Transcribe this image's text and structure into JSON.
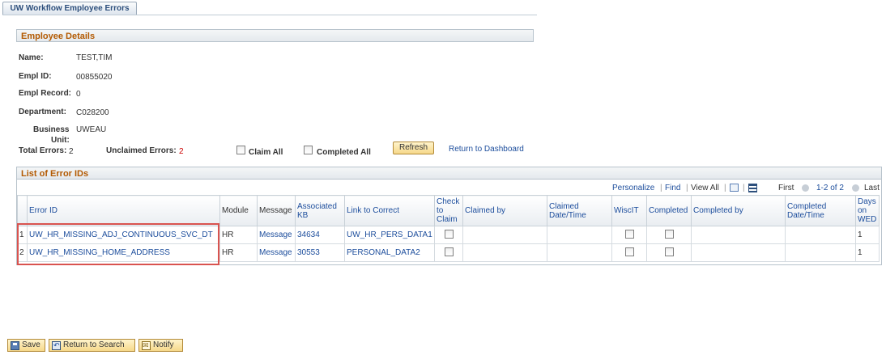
{
  "tab": {
    "label": "UW Workflow Employee Errors"
  },
  "employee_details": {
    "header": "Employee Details",
    "name_label": "Name:",
    "name_value": "TEST,TIM",
    "emplid_label": "Empl ID:",
    "emplid_value": "00855020",
    "empl_record_label": "Empl Record:",
    "empl_record_value": "0",
    "department_label": "Department:",
    "department_value": "C028200",
    "business_unit_label_1": "Business",
    "business_unit_label_2": "Unit:",
    "business_unit_value": "UWEAU",
    "total_errors_label": "Total Errors:",
    "total_errors_value": "2",
    "unclaimed_errors_label": "Unclaimed Errors:",
    "unclaimed_errors_value": "2",
    "claim_all_label": "Claim All",
    "completed_all_label": "Completed All",
    "refresh_label": "Refresh",
    "return_dashboard_label": "Return to Dashboard"
  },
  "error_list": {
    "header": "List of Error IDs",
    "nav": {
      "personalize": "Personalize",
      "find": "Find",
      "view_all": "View All",
      "first": "First",
      "range": "1-2 of 2",
      "last": "Last"
    },
    "columns": {
      "error_id": "Error ID",
      "module": "Module",
      "message": "Message",
      "associated_kb_1": "Associated",
      "associated_kb_2": "KB",
      "link_to_correct": "Link to Correct",
      "check_to_claim_1": "Check",
      "check_to_claim_2": "to",
      "check_to_claim_3": "Claim",
      "claimed_by": "Claimed by",
      "claimed_datetime_1": "Claimed",
      "claimed_datetime_2": "Date/Time",
      "wiscit": "WiscIT",
      "completed": "Completed",
      "completed_by": "Completed by",
      "completed_datetime_1": "Completed",
      "completed_datetime_2": "Date/Time",
      "days_on_wed_1": "Days",
      "days_on_wed_2": "on",
      "days_on_wed_3": "WED"
    },
    "rows": [
      {
        "num": "1",
        "error_id": "UW_HR_MISSING_ADJ_CONTINUOUS_SVC_DT",
        "module": "HR",
        "message": "Message",
        "kb": "34634",
        "link": "UW_HR_PERS_DATA1",
        "days": "1"
      },
      {
        "num": "2",
        "error_id": "UW_HR_MISSING_HOME_ADDRESS",
        "module": "HR",
        "message": "Message",
        "kb": "30553",
        "link": "PERSONAL_DATA2",
        "days": "1"
      }
    ]
  },
  "toolbar": {
    "save": "Save",
    "return_to_search": "Return to Search",
    "notify": "Notify"
  }
}
